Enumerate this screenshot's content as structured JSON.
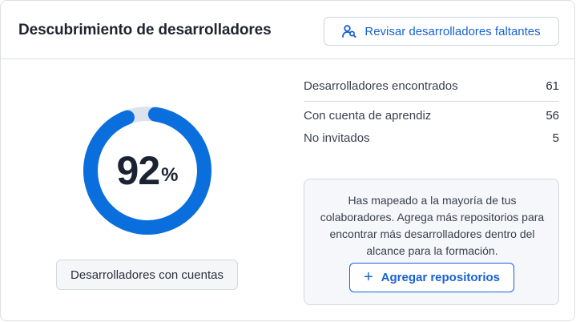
{
  "header": {
    "title": "Descubrimiento de desarrolladores",
    "review_button_label": "Revisar desarrolladores faltantes",
    "review_button_icon": "user-search-icon"
  },
  "gauge": {
    "value": "92",
    "unit": "%",
    "fraction": 0.92,
    "caption": "Desarrolladores con cuentas",
    "colors": {
      "fill": "#0a6fdc",
      "track": "#dde3ee"
    }
  },
  "stats": {
    "found": {
      "label": "Desarrolladores encontrados",
      "value": "61"
    },
    "with_account": {
      "label": "Con cuenta de aprendiz",
      "value": "56"
    },
    "not_invited": {
      "label": "No invitados",
      "value": "5"
    }
  },
  "info": {
    "text": "Has mapeado a la mayoría de tus colaboradores. Agrega más repositorios para encontrar más desarrolladores dentro del alcance para la formación.",
    "add_button_label": "Agregar repositorios",
    "add_button_icon": "plus-icon"
  },
  "colors": {
    "accent": "#1762d0"
  }
}
